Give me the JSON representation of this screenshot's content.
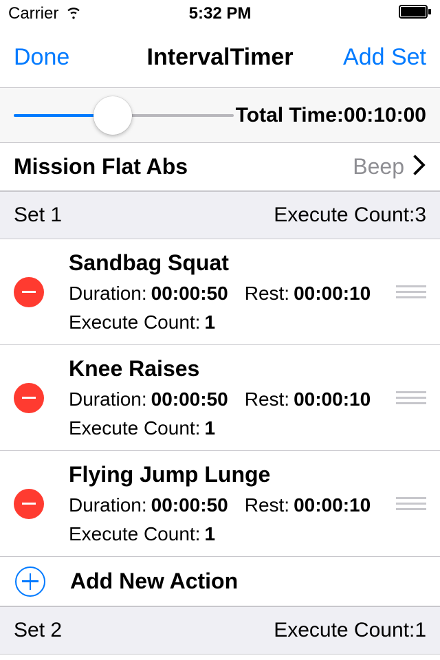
{
  "status": {
    "carrier": "Carrier",
    "time": "5:32 PM"
  },
  "nav": {
    "left": "Done",
    "title": "IntervalTimer",
    "right": "Add Set"
  },
  "slider": {
    "total_time_label": "Total Time:",
    "total_time_value": "00:10:00"
  },
  "mission": {
    "title": "Mission Flat Abs",
    "sound": "Beep"
  },
  "labels": {
    "duration": "Duration:",
    "rest": "Rest:",
    "execute_count": "Execute Count:",
    "add_action": "Add New Action",
    "set_execute_count": "Execute Count:"
  },
  "sets": [
    {
      "title": "Set 1",
      "execute_count": "3",
      "actions": [
        {
          "name": "Sandbag Squat",
          "duration": "00:00:50",
          "rest": "00:00:10",
          "execute_count": "1"
        },
        {
          "name": "Knee Raises",
          "duration": "00:00:50",
          "rest": "00:00:10",
          "execute_count": "1"
        },
        {
          "name": "Flying Jump Lunge",
          "duration": "00:00:50",
          "rest": "00:00:10",
          "execute_count": "1"
        }
      ]
    },
    {
      "title": "Set 2",
      "execute_count": "1",
      "actions": []
    }
  ]
}
